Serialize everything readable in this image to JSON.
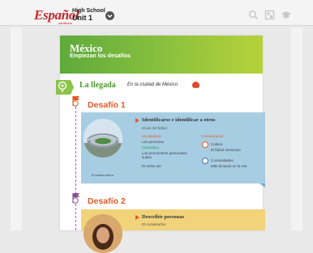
{
  "topbar": {
    "logo": "Español",
    "logo_sub": "santillana",
    "course_line1": "High School",
    "course_line2": "Unit 1"
  },
  "icons": [
    "chevron-down-icon",
    "search-icon",
    "grid-icon",
    "graduation-cap-icon"
  ],
  "header": {
    "title": "México",
    "subtitle": "Empiezan los desafíos"
  },
  "llegada": {
    "title": "La llegada",
    "subtitle": "En la ciudad de México"
  },
  "desafio1": {
    "label": "Desafío 1",
    "card_title": "Identificarse e identificar a otros",
    "card_subtitle": "El pie del fútbol",
    "image_caption": "El estadio Azteca",
    "vocab_head": "Vocabulario",
    "vocab_items": [
      "Las personas"
    ],
    "gram_head": "Gramática",
    "gram_items": [
      "Los pronombres personales sujeto",
      "El verbo ser"
    ],
    "comm_head": "Comunicación",
    "comm_items": [
      "Cultura",
      "El fútbol mexicano"
    ],
    "comm2_items": [
      "Comunidades",
      "Más lecturas en la red"
    ]
  },
  "desafio2": {
    "label": "Desafío 2",
    "card_title": "Describir personas",
    "card_subtitle": "El cumpleaños"
  },
  "colors": {
    "accent": "#e25a26",
    "brand": "#c8282e",
    "header_green": "#8dc23e",
    "card1": "#a7cde3",
    "card2": "#f1d37a",
    "timeline": "#a06aa8"
  }
}
